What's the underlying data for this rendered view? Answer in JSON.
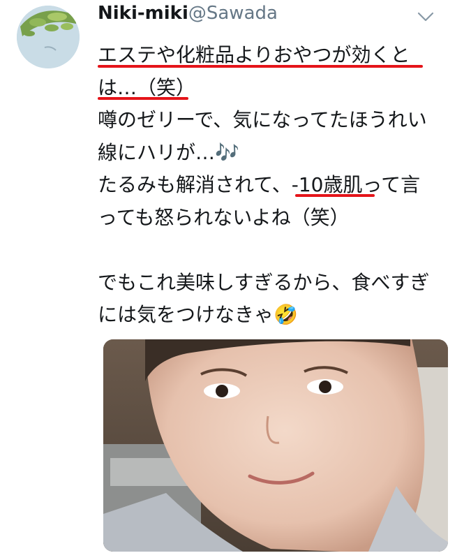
{
  "tweet": {
    "author_name": "Niki-miki",
    "author_handle": "@Sawada",
    "lines": [
      "エステや化粧品よりおやつが効くと",
      "は…（笑）",
      "噂のゼリーで、気になってたほうれい",
      "線にハリが…🎶",
      "たるみも解消されて、-10歳肌って言",
      "っても怒られないよね（笑）",
      "",
      "でもこれ美味しすぎるから、食べすぎ",
      "には気をつけなきゃ🤣"
    ]
  },
  "icons": {
    "menu": "chevron-down-icon",
    "avatar": "avatar-image",
    "media": "selfie-photo"
  },
  "colors": {
    "underline": "#e5141a",
    "handle": "#657786",
    "text": "#14171a"
  }
}
